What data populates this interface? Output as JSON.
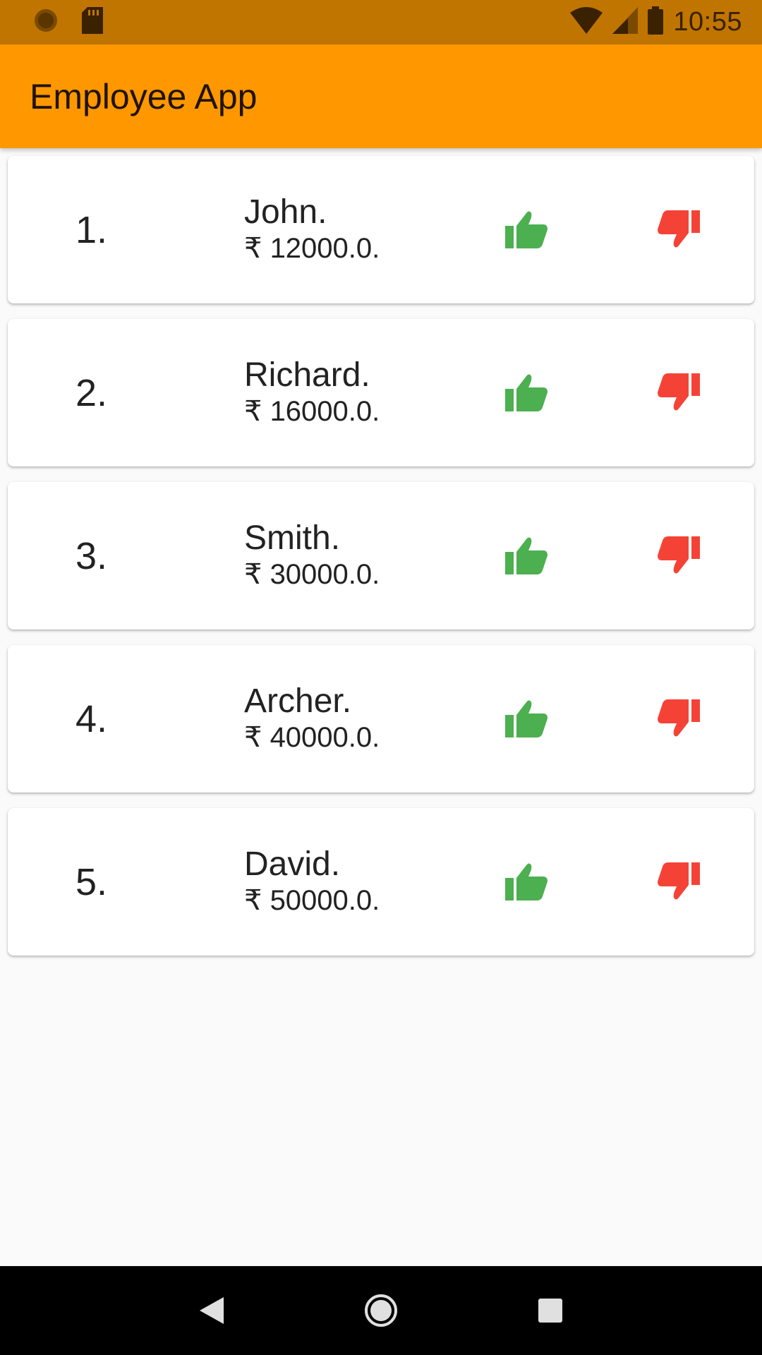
{
  "status_bar": {
    "time": "10:55",
    "left_icons": [
      "settings-icon",
      "sd-card-icon"
    ],
    "right_icons": [
      "wifi-icon",
      "signal-icon",
      "battery-icon"
    ]
  },
  "app_bar": {
    "title": "Employee App"
  },
  "employees": [
    {
      "index": "1.",
      "name": "John.",
      "salary": "₹ 12000.0."
    },
    {
      "index": "2.",
      "name": "Richard.",
      "salary": "₹ 16000.0."
    },
    {
      "index": "3.",
      "name": "Smith.",
      "salary": "₹ 30000.0."
    },
    {
      "index": "4.",
      "name": "Archer.",
      "salary": "₹ 40000.0."
    },
    {
      "index": "5.",
      "name": "David.",
      "salary": "₹ 50000.0."
    }
  ],
  "icons": {
    "like": "thumb-up-icon",
    "dislike": "thumb-down-icon"
  },
  "colors": {
    "status_bar": "#c07500",
    "app_bar": "#ff9800",
    "like": "#4caf50",
    "dislike": "#f44336"
  },
  "nav_bar": {
    "icons": [
      "back-icon",
      "home-icon",
      "recents-icon"
    ]
  }
}
